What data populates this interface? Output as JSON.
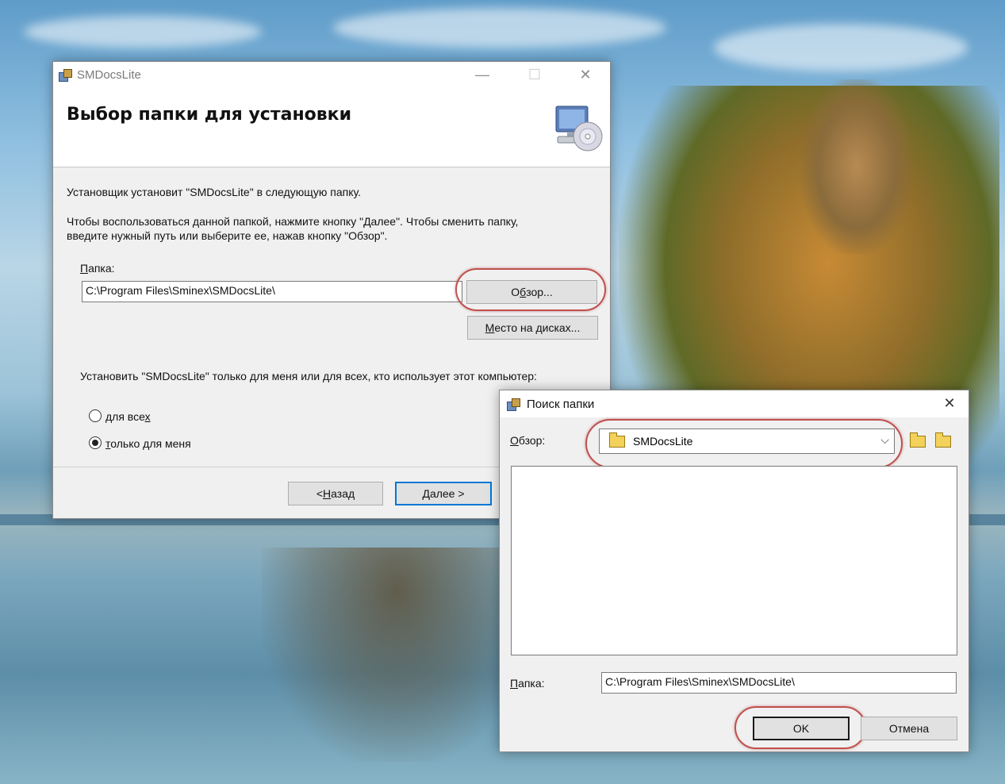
{
  "installer": {
    "title": "SMDocsLite",
    "controls": {
      "minimize": "—",
      "maximize": "☐",
      "close": "✕"
    },
    "header_title": "Выбор папки для установки",
    "intro": "Установщик установит \"SMDocsLite\" в следующую папку.",
    "instruction_line1": "Чтобы воспользоваться данной папкой, нажмите кнопку \"Далее\". Чтобы сменить папку,",
    "instruction_line2": "введите нужный путь или выберите ее, нажав кнопку \"Обзор\".",
    "folder_label_hotkey": "П",
    "folder_label_rest": "апка:",
    "folder_value": "C:\\Program Files\\Sminex\\SMDocsLite\\",
    "browse_pre": "О",
    "browse_hotkey": "б",
    "browse_post": "зор...",
    "disk_hotkey": "М",
    "disk_rest": "есто на дисках...",
    "scope_question": "Установить \"SMDocsLite\" только для меня или для всех, кто использует этот компьютер:",
    "radio_all_pre": "для все",
    "radio_all_hotkey": "х",
    "radio_me_hotkey": "т",
    "radio_me_rest": "олько для меня",
    "selected_scope": "только для меня",
    "back_pre": "< ",
    "back_hotkey": "Н",
    "back_rest": "азад",
    "next_hotkey": "Д",
    "next_rest": "алее >"
  },
  "browse_dialog": {
    "title": "Поиск папки",
    "close": "✕",
    "browse_label_hotkey": "О",
    "browse_label_rest": "бзор:",
    "combo_value": "SMDocsLite",
    "combo_arrow": "⌵",
    "folder_label_hotkey": "П",
    "folder_label_rest": "апка:",
    "folder_value": "C:\\Program Files\\Sminex\\SMDocsLite\\",
    "ok": "OK",
    "cancel": "Отмена"
  },
  "icons": [
    "installer-app-icon",
    "computer-cd-icon",
    "new-folder-icon",
    "up-folder-icon",
    "create-folder-icon"
  ],
  "highlight_color": "#c0504d"
}
